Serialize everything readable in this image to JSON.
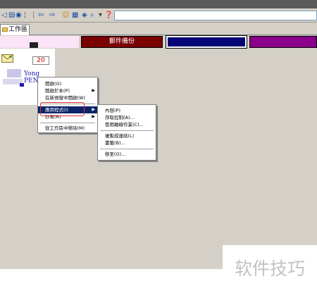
{
  "toolbar": {
    "address_value": ""
  },
  "tabs": {
    "workspace_label": "工作區"
  },
  "category_bar": {
    "backup_label": "郵件備份"
  },
  "workspace": {
    "unread_count": "20",
    "user_name_line1": "Yong",
    "user_name_line2": "PEN"
  },
  "context_menu": {
    "items": [
      {
        "label": "開啟(O)",
        "submenu": false
      },
      {
        "label": "開啟於本(P)",
        "submenu": true
      },
      {
        "label": "在新視窗中開啟(W)",
        "submenu": false
      },
      {
        "label": "應用程式(I)",
        "submenu": true
      },
      {
        "label": "抄寫(R)",
        "submenu": true
      },
      {
        "label": "從工作區中移除(M)",
        "submenu": false
      }
    ]
  },
  "sub_menu": {
    "items": [
      {
        "label": "內容(P)"
      },
      {
        "label": "存取控制(A)..."
      },
      {
        "label": "管用離線作業(C)..."
      },
      {
        "label": "複製成連結(L)"
      },
      {
        "label": "書籤(B)..."
      },
      {
        "label": "移至(O)..."
      }
    ]
  },
  "watermark": {
    "text": "软件技巧"
  },
  "colors": {
    "selection": "#0a246a",
    "highlight_box": "#e03030",
    "backup_tab": "#7a0000",
    "navy_tab": "#050576",
    "purple_tab": "#8a008a"
  },
  "icons": [
    "envelope-icon",
    "folder-icon",
    "back-arrow-icon",
    "forward-arrow-icon",
    "home-icon",
    "search-icon",
    "submenu-arrow-icon"
  ]
}
